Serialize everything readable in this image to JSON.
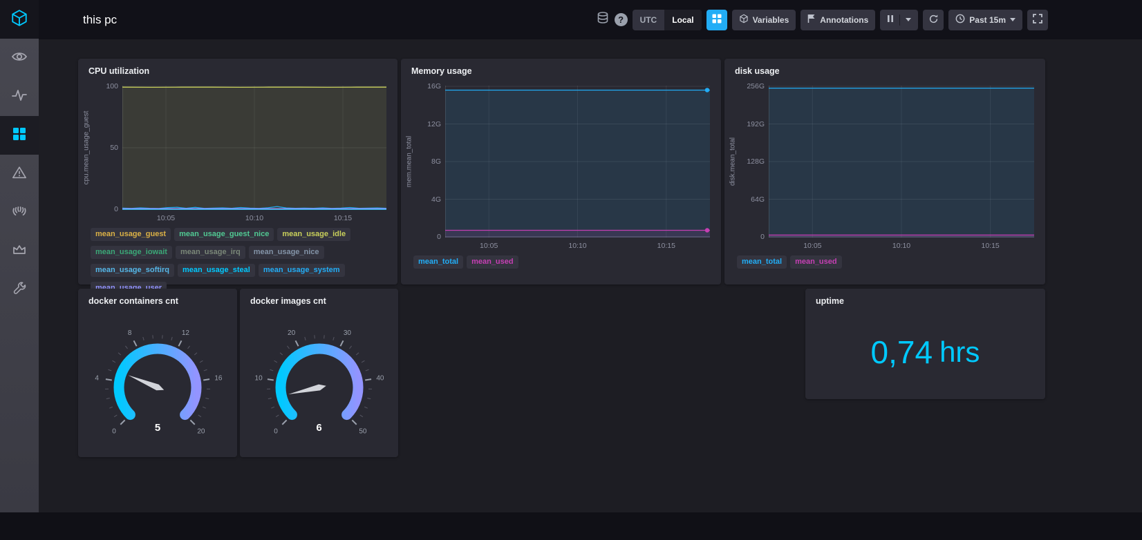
{
  "header": {
    "title": "this pc",
    "utc_label": "UTC",
    "local_label": "Local",
    "variables_label": "Variables",
    "annotations_label": "Annotations",
    "time_range_label": "Past 15m"
  },
  "sidebar": {
    "accent": "#00C9FF",
    "icons": [
      "chronograf-logo",
      "host-list",
      "data-explorer",
      "dashboards",
      "alerting",
      "admin-influxdb",
      "admin-chronograf",
      "configuration"
    ],
    "active": "dashboards"
  },
  "chart_data": [
    {
      "id": "cpu",
      "type": "area",
      "title": "CPU utilization",
      "ylabel": "cpu.mean_usage_guest",
      "ylim": [
        0,
        100
      ],
      "y_ticks": [
        {
          "v": 0,
          "label": "0"
        },
        {
          "v": 50,
          "label": "50"
        },
        {
          "v": 100,
          "label": "100"
        }
      ],
      "x_ticks": [
        {
          "f": 0.165,
          "label": "10:05"
        },
        {
          "f": 0.5,
          "label": "10:10"
        },
        {
          "f": 0.835,
          "label": "10:15"
        }
      ],
      "series": [
        {
          "name": "mean_usage_guest",
          "color": "#DBB146",
          "values": [
            0,
            0
          ]
        },
        {
          "name": "mean_usage_guest_nice",
          "color": "#51C993",
          "values": [
            0,
            0
          ]
        },
        {
          "name": "mean_usage_idle",
          "color": "#C9D05B",
          "fill": true,
          "values": [
            99.3,
            99.2,
            99.3,
            99.3,
            99.2,
            99.3,
            99.3,
            99.2,
            99.3,
            99.3
          ]
        },
        {
          "name": "mean_usage_iowait",
          "color": "#3BA877",
          "values": [
            0,
            0
          ]
        },
        {
          "name": "mean_usage_irq",
          "color": "#7A8778",
          "values": [
            0,
            0
          ]
        },
        {
          "name": "mean_usage_nice",
          "color": "#8393A7",
          "values": [
            0,
            0
          ]
        },
        {
          "name": "mean_usage_softirq",
          "color": "#55B7E8",
          "values": [
            0,
            0
          ]
        },
        {
          "name": "mean_usage_steal",
          "color": "#00C9FF",
          "values": [
            0,
            0
          ]
        },
        {
          "name": "mean_usage_system",
          "color": "#22ADF6",
          "values": [
            0.9,
            0.7,
            1.1,
            0.8,
            0.6,
            1.3,
            1.6,
            0.8,
            1.5,
            0.7,
            0.9,
            1.1,
            0.8,
            1.4,
            0.9,
            0.7,
            1.2,
            2.2,
            1.0,
            0.8,
            0.9,
            0.8,
            1.1,
            0.7,
            0.9,
            1.4,
            0.8,
            0.9,
            1.0,
            0.8
          ]
        },
        {
          "name": "mean_usage_user",
          "color": "#9394FF",
          "values": [
            0.4,
            0.4
          ]
        }
      ]
    },
    {
      "id": "memory",
      "type": "area",
      "title": "Memory usage",
      "ylabel": "mem.mean_total",
      "ylim": [
        0,
        16
      ],
      "y_ticks": [
        {
          "v": 0,
          "label": "0"
        },
        {
          "v": 4,
          "label": "4G"
        },
        {
          "v": 8,
          "label": "8G"
        },
        {
          "v": 12,
          "label": "12G"
        },
        {
          "v": 16,
          "label": "16G"
        }
      ],
      "x_ticks": [
        {
          "f": 0.165,
          "label": "10:05"
        },
        {
          "f": 0.5,
          "label": "10:10"
        },
        {
          "f": 0.835,
          "label": "10:15"
        }
      ],
      "series": [
        {
          "name": "mean_total",
          "color": "#22ADF6",
          "fill": true,
          "end_dot": true,
          "values": [
            15.6,
            15.6
          ]
        },
        {
          "name": "mean_used",
          "color": "#C63FB4",
          "fill": true,
          "end_dot": true,
          "values": [
            0.7,
            0.7
          ]
        }
      ]
    },
    {
      "id": "disk",
      "type": "area",
      "title": "disk usage",
      "ylabel": "disk.mean_total",
      "ylim": [
        0,
        256
      ],
      "y_ticks": [
        {
          "v": 0,
          "label": "0"
        },
        {
          "v": 64,
          "label": "64G"
        },
        {
          "v": 128,
          "label": "128G"
        },
        {
          "v": 192,
          "label": "192G"
        },
        {
          "v": 256,
          "label": "256G"
        }
      ],
      "x_ticks": [
        {
          "f": 0.165,
          "label": "10:05"
        },
        {
          "f": 0.5,
          "label": "10:10"
        },
        {
          "f": 0.835,
          "label": "10:15"
        }
      ],
      "series": [
        {
          "name": "mean_total",
          "color": "#22ADF6",
          "fill": true,
          "values": [
            253,
            253
          ]
        },
        {
          "name": "mean_used",
          "color": "#C63FB4",
          "fill": true,
          "values": [
            3,
            3
          ]
        }
      ]
    },
    {
      "id": "docker_containers",
      "type": "gauge",
      "title": "docker containers cnt",
      "min": 0,
      "max": 20,
      "ticks": [
        "0",
        "4",
        "8",
        "12",
        "16",
        "20"
      ],
      "value": 5,
      "value_label": "5",
      "colors": [
        "#00C9FF",
        "#9394FF"
      ]
    },
    {
      "id": "docker_images",
      "type": "gauge",
      "title": "docker images cnt",
      "min": 0,
      "max": 50,
      "ticks": [
        "0",
        "10",
        "20",
        "30",
        "40",
        "50"
      ],
      "value": 6,
      "value_label": "6",
      "colors": [
        "#00C9FF",
        "#9394FF"
      ]
    },
    {
      "id": "uptime",
      "type": "single_stat",
      "title": "uptime",
      "value": "0,74",
      "unit": "hrs",
      "color": "#00C9FF"
    }
  ]
}
